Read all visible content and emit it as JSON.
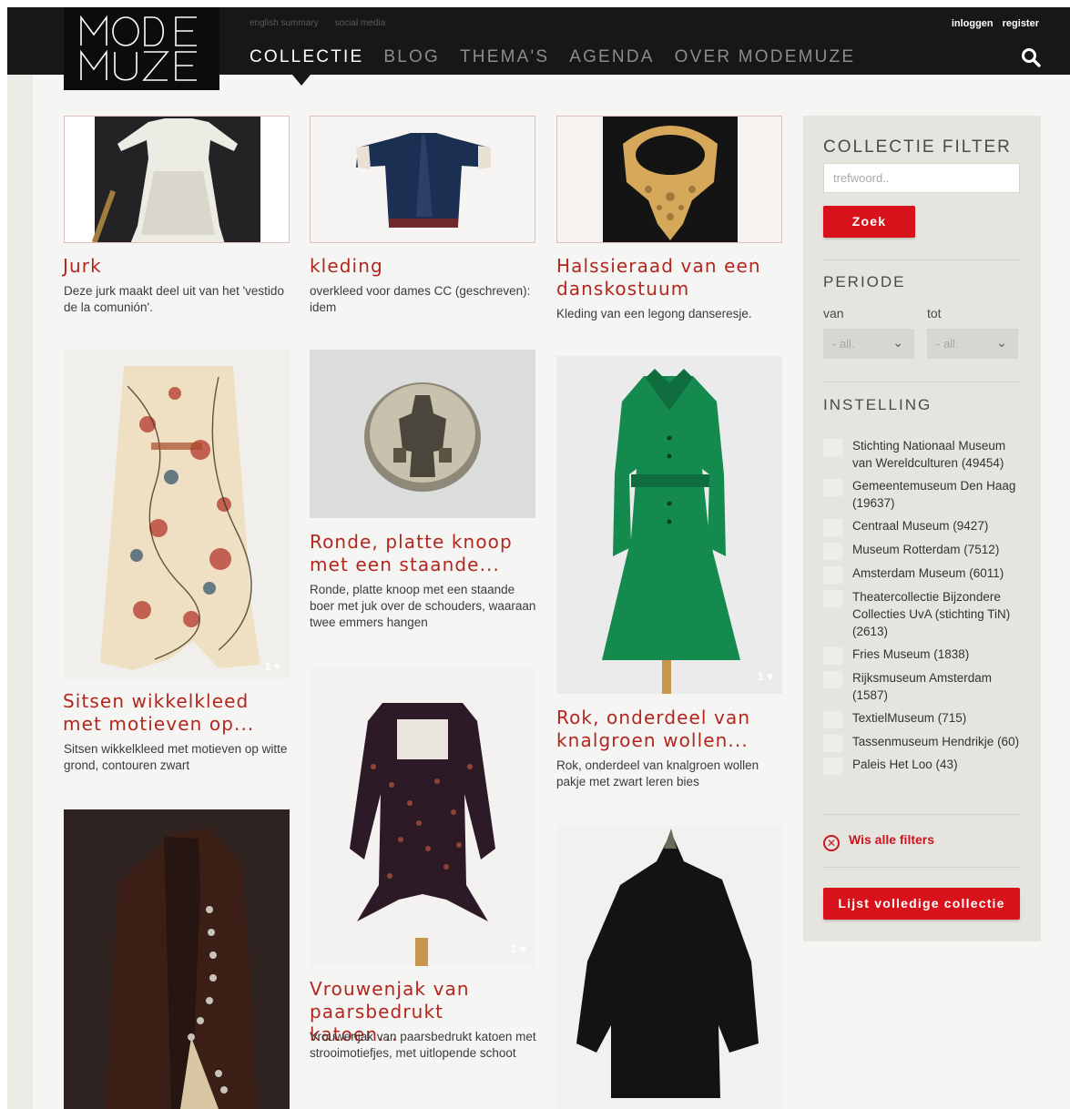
{
  "header": {
    "logo_text": "MODE MUZE",
    "lang_links": [
      "english summary",
      "social media"
    ],
    "nav": [
      "COLLECTIE",
      "BLOG",
      "THEMA'S",
      "AGENDA",
      "OVER MODEMUZE"
    ],
    "auth": {
      "login": "inloggen",
      "register": "register"
    },
    "search_icon": "search-icon"
  },
  "cards": [
    {
      "title": "Jurk",
      "desc": "Deze jurk maakt deel uit van het 'vestido de la comunión'."
    },
    {
      "title": "kleding",
      "desc": "overkleed voor dames CC (geschreven): idem"
    },
    {
      "title": "Halssieraad van een danskostuum",
      "desc": "Kleding van een legong danseresje."
    },
    {
      "title": "Sitsen wikkelkleed met motieven op...",
      "desc": "Sitsen wikkelkleed met motieven op witte grond, contouren zwart",
      "likes": "1"
    },
    {
      "title": "Ronde, platte knoop met een staande...",
      "desc": "Ronde, platte knoop met een staande boer met juk over de schouders, waaraan twee emmers hangen"
    },
    {
      "title": "Rok, onderdeel van knalgroen wollen...",
      "desc": "Rok, onderdeel van knalgroen wollen pakje met zwart leren bies",
      "likes": "1"
    },
    {
      "title": "Vrouwenjak van paarsbedrukt katoen...",
      "desc": "Vrouwenjak van paarsbedrukt katoen met strooimotiefjes, met uitlopende schoot",
      "likes": "1"
    }
  ],
  "sidebar": {
    "title": "COLLECTIE FILTER",
    "search_placeholder": "trefwoord..",
    "search_button": "Zoek",
    "period_title": "PERIODE",
    "from_label": "van",
    "to_label": "tot",
    "from_value": "- all.",
    "to_value": "- all.",
    "institution_title": "INSTELLING",
    "institutions": [
      "Stichting Nationaal Museum van Wereldculturen (49454)",
      "Gemeentemuseum Den Haag (19637)",
      "Centraal Museum (9427)",
      "Museum Rotterdam (7512)",
      "Amsterdam Museum (6011)",
      "Theatercollectie Bijzondere Collecties UvA (stichting TiN) (2613)",
      "Fries Museum (1838)",
      "Rijksmuseum Amsterdam (1587)",
      "TextielMuseum (715)",
      "Tassenmuseum Hendrikje (60)",
      "Paleis Het Loo (43)"
    ],
    "clear_filters": "Wis alle filters",
    "full_list_button": "Lijst volledige collectie"
  }
}
